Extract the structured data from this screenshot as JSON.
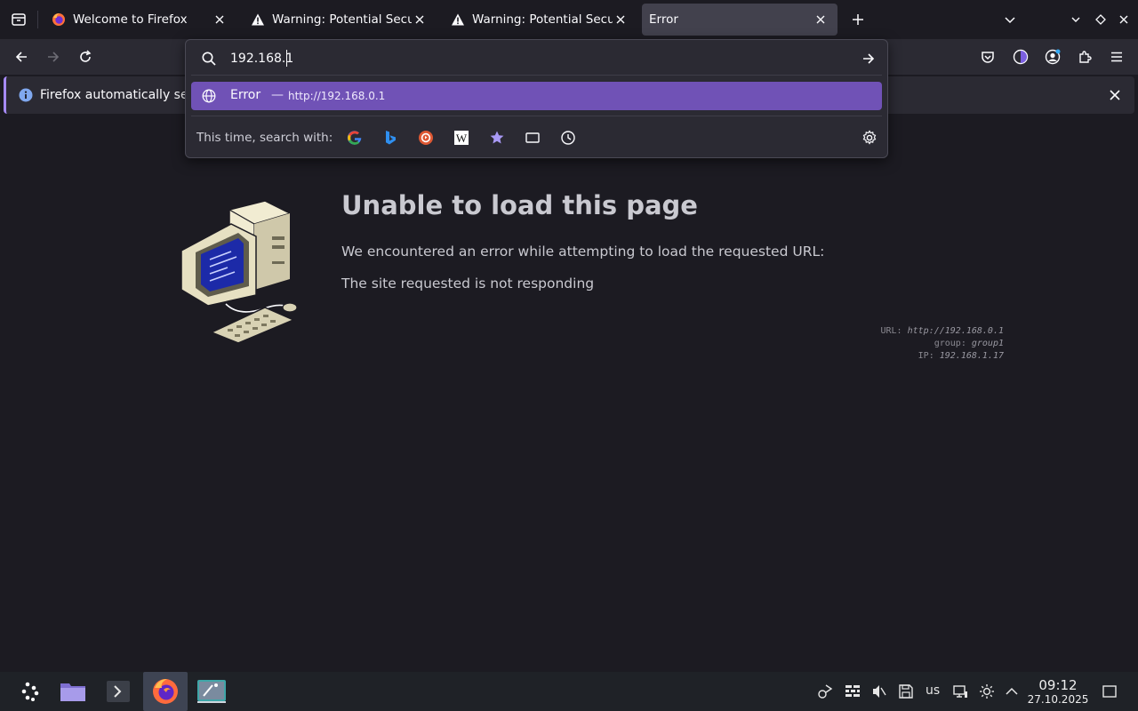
{
  "tabs": [
    {
      "title": "Welcome to Firefox",
      "icon": "firefox-icon",
      "active": false
    },
    {
      "title": "Warning: Potential Security",
      "icon": "warning-icon",
      "active": false
    },
    {
      "title": "Warning: Potential Security",
      "icon": "warning-icon",
      "active": false
    },
    {
      "title": "Error",
      "icon": "",
      "active": true
    }
  ],
  "notification": {
    "text": "Firefox automatically sends"
  },
  "urlbar": {
    "value": "192.168.1",
    "result": {
      "title": "Error",
      "dash": "—",
      "url": "http://192.168.0.1"
    },
    "one_time_label": "This time, search with:",
    "engines": [
      "google-icon",
      "bing-icon",
      "duckduckgo-icon",
      "wikipedia-icon",
      "bookmarks-icon",
      "tabs-icon",
      "history-icon"
    ]
  },
  "page": {
    "title": "Unable to load this page",
    "line1": "We encountered an error while attempting to load the requested URL:",
    "line2": "The site requested is not responding",
    "meta": {
      "url_label": "URL:",
      "url_value": "http://192.168.0.1",
      "group_label": "group:",
      "group_value": "group1",
      "ip_label": "IP:",
      "ip_value": "192.168.1.17"
    }
  },
  "taskbar": {
    "keyboard_layout": "us",
    "time": "09:12",
    "date": "27.10.2025"
  },
  "colors": {
    "accent": "#7052b6",
    "notification_border": "#a78bfa",
    "background": "#1c1b22"
  }
}
